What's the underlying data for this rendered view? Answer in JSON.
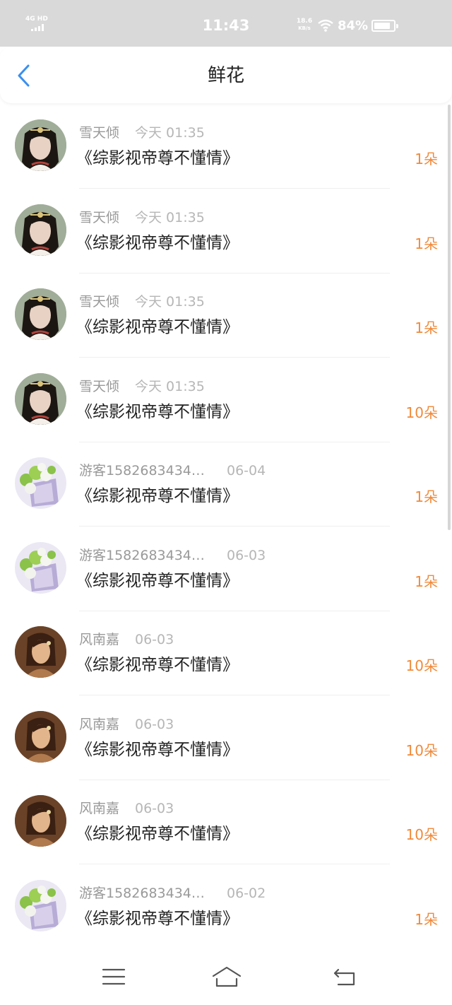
{
  "status_bar": {
    "network": "4G HD",
    "time": "11:43",
    "speed_value": "18.6",
    "speed_unit": "KB/s",
    "battery": "84%",
    "battery_level": 0.84
  },
  "header": {
    "title": "鲜花",
    "back_icon": "chevron-left-icon"
  },
  "rows": [
    {
      "name": "雪天倾",
      "time": "今天 01:35",
      "book": "《综影视帝尊不懂情》",
      "count": "1朵",
      "avatar": "avatar-lady"
    },
    {
      "name": "雪天倾",
      "time": "今天 01:35",
      "book": "《综影视帝尊不懂情》",
      "count": "1朵",
      "avatar": "avatar-lady"
    },
    {
      "name": "雪天倾",
      "time": "今天 01:35",
      "book": "《综影视帝尊不懂情》",
      "count": "1朵",
      "avatar": "avatar-lady"
    },
    {
      "name": "雪天倾",
      "time": "今天 01:35",
      "book": "《综影视帝尊不懂情》",
      "count": "10朵",
      "avatar": "avatar-lady"
    },
    {
      "name": "游客1582683434…",
      "time": "06-04",
      "book": "《综影视帝尊不懂情》",
      "count": "1朵",
      "avatar": "avatar-flowers"
    },
    {
      "name": "游客1582683434…",
      "time": "06-03",
      "book": "《综影视帝尊不懂情》",
      "count": "1朵",
      "avatar": "avatar-flowers"
    },
    {
      "name": "风南嘉",
      "time": "06-03",
      "book": "《综影视帝尊不懂情》",
      "count": "10朵",
      "avatar": "avatar-painting"
    },
    {
      "name": "风南嘉",
      "time": "06-03",
      "book": "《综影视帝尊不懂情》",
      "count": "10朵",
      "avatar": "avatar-painting"
    },
    {
      "name": "风南嘉",
      "time": "06-03",
      "book": "《综影视帝尊不懂情》",
      "count": "10朵",
      "avatar": "avatar-painting"
    },
    {
      "name": "游客1582683434…",
      "time": "06-02",
      "book": "《综影视帝尊不懂情》",
      "count": "1朵",
      "avatar": "avatar-flowers"
    }
  ],
  "nav": {
    "menu_icon": "menu-icon",
    "home_icon": "home-icon",
    "back_icon": "back-icon"
  },
  "colors": {
    "accent_orange": "#f08a3a",
    "back_blue": "#3a8ff0",
    "status_bar_bg": "#d9d9d9"
  }
}
